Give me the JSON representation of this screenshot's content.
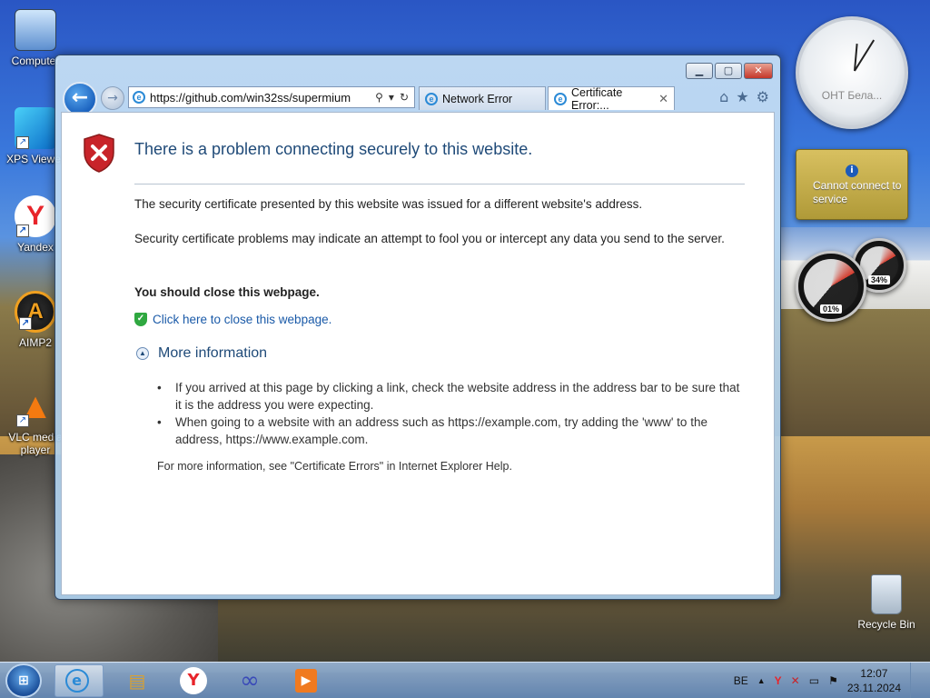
{
  "desktop": {
    "icons": [
      {
        "label": "Computer",
        "glyph": "🖥"
      },
      {
        "label": "XPS Viewer",
        "glyph": "✈"
      },
      {
        "label": "Yandex",
        "glyph": "Y"
      },
      {
        "label": "AIMP2",
        "glyph": "A"
      },
      {
        "label": "VLC media player",
        "glyph": "▲"
      }
    ],
    "recycle_bin_label": "Recycle Bin",
    "shortcut_glyph": "↗"
  },
  "gadgets": {
    "clock_label": "ОНТ Бела...",
    "weather_text": "Cannot connect to service",
    "weather_icon": "i",
    "cpu_gauge_readout": "01%",
    "ram_gauge_readout": "34%"
  },
  "browser": {
    "caption": {
      "minimize": "▁",
      "maximize": "▢",
      "close": "✕"
    },
    "nav": {
      "back": "←",
      "forward": "→"
    },
    "address": {
      "url": "https://github.com/win32ss/supermium",
      "ie_glyph": "e",
      "search_glyph": "⚲",
      "dropdown_glyph": "▾",
      "refresh_glyph": "↻"
    },
    "tabs": [
      {
        "title": "Network Error"
      },
      {
        "title": "Certificate Error:...",
        "close": "✕"
      }
    ],
    "tools": {
      "home": "⌂",
      "favorites": "★",
      "settings": "⚙"
    }
  },
  "page": {
    "title": "There is a problem connecting securely to this website.",
    "para1": "The security certificate presented by this website was issued for a different website's address.",
    "para2": "Security certificate problems may indicate an attempt to fool you or intercept any data you send to the server.",
    "recommendation": "You should close this webpage.",
    "close_link": "Click here to close this webpage.",
    "check_glyph": "✓",
    "more_info": "More information",
    "collapse_glyph": "▲",
    "bullets": [
      "If you arrived at this page by clicking a link, check the website address in the address bar to be sure that it is the address you were expecting.",
      "When going to a website with an address such as https://example.com, try adding the 'www' to the address, https://www.example.com."
    ],
    "help_note": "For more information, see \"Certificate Errors\" in Internet Explorer Help."
  },
  "taskbar": {
    "start_glyph": "⊞",
    "items": [
      {
        "name": "Internet Explorer",
        "glyph": "e",
        "active": true
      },
      {
        "name": "File Explorer",
        "glyph": "▤"
      },
      {
        "name": "Yandex",
        "glyph": "Y"
      },
      {
        "name": "Infinity",
        "glyph": "∞"
      },
      {
        "name": "Media Player",
        "glyph": "▶"
      }
    ],
    "language": "BE",
    "tray_up": "▲",
    "tray_icons": [
      "Y",
      "✕",
      "▭",
      "⚑"
    ],
    "time": "12:07",
    "date": "23.11.2024"
  },
  "colors": {
    "title_blue": "#1f4a78",
    "link_blue": "#1a5aa8",
    "error_red": "#c8242a",
    "accent_blue": "#1c64c0"
  }
}
